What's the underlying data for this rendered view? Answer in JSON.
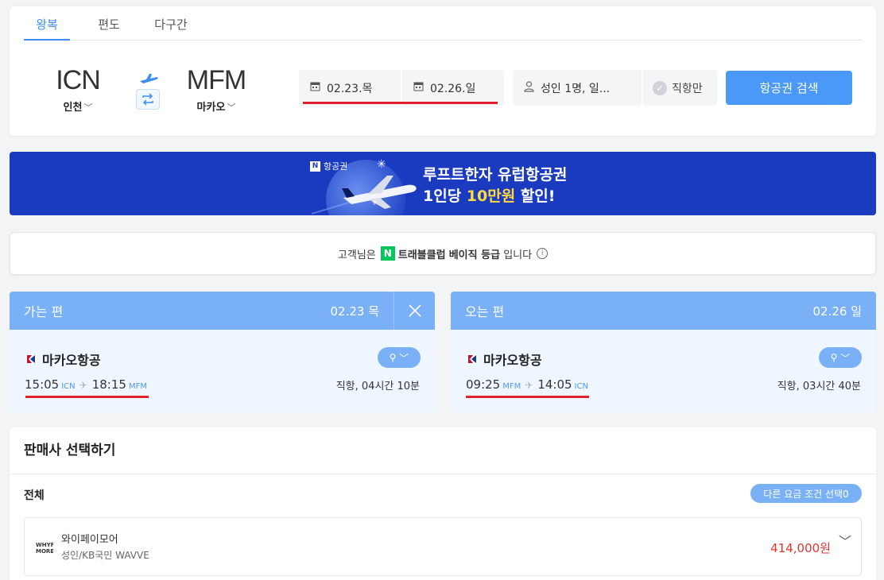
{
  "tabs": [
    "왕복",
    "편도",
    "다구간"
  ],
  "route": {
    "from_code": "ICN",
    "from_name": "인천",
    "to_code": "MFM",
    "to_name": "마카오"
  },
  "dates": {
    "out": "02.23.목",
    "in": "02.26.일"
  },
  "passengers": "성인 1명, 일...",
  "direct_only": "직항만",
  "search_button": "항공권 검색",
  "banner": {
    "badge": "항공권",
    "line1": "루프트한자 유럽항공권",
    "line2_pre": "1인당 ",
    "line2_hl": "10만원",
    "line2_post": " 할인!"
  },
  "grade": {
    "pre": "고객님은",
    "club": "트래블클럽",
    "level": "베이직 등급",
    "post": "입니다"
  },
  "outbound": {
    "header": "가는 편",
    "date": "02.23 목",
    "airline": "마카오항공",
    "dep_time": "15:05",
    "dep_ap": "ICN",
    "arr_time": "18:15",
    "arr_ap": "MFM",
    "duration": "직항, 04시간 10분"
  },
  "inbound": {
    "header": "오는 편",
    "date": "02.26 일",
    "airline": "마카오항공",
    "dep_time": "09:25",
    "dep_ap": "MFM",
    "arr_time": "14:05",
    "arr_ap": "ICN",
    "duration": "직항, 03시간 40분"
  },
  "seller": {
    "title": "판매사 선택하기",
    "all_label": "전체",
    "fare_button": "다른 요금 조건 선택0",
    "vendor": {
      "logo_text": "WHYPAY MORE",
      "name": "와이페이모어",
      "sub": "성인/KB국민 WAVVE",
      "price": "414,000원"
    }
  },
  "colors": {
    "accent": "#4a98f7",
    "highlight_line": "#e0222e",
    "banner_bg": "#1a3bc0",
    "price": "#e5352f"
  }
}
